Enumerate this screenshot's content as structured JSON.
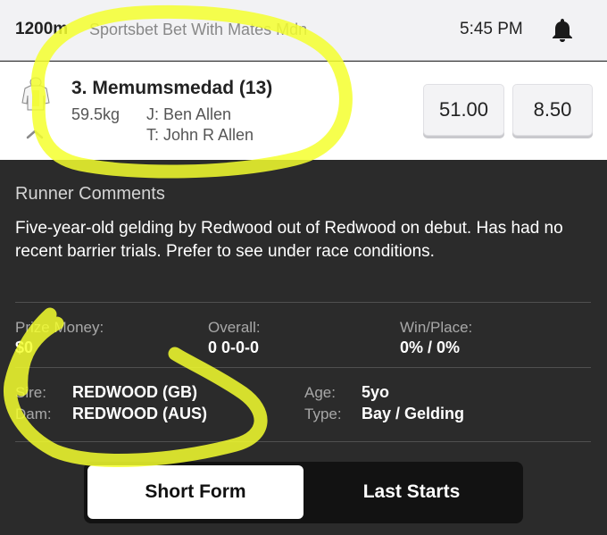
{
  "header": {
    "distance": "1200m",
    "race_name": "Sportsbet Bet With Mates Mdn",
    "time": "5:45 PM",
    "bell_icon": "bell-icon"
  },
  "runner": {
    "name": "3. Memumsmedad (13)",
    "weight": "59.5kg",
    "jockey": "J: Ben Allen",
    "trainer": "T: John R Allen",
    "odds_win": "51.00",
    "odds_place": "8.50",
    "silks_icon": "jockey-silks-icon",
    "collapse_icon": "chevron-up-icon"
  },
  "comments": {
    "title": "Runner Comments",
    "text": "Five-year-old gelding by Redwood out of Redwood on debut. Has had no recent barrier trials. Prefer to see under race conditions."
  },
  "stats": {
    "prize_label": "Prize Money:",
    "prize_value": "$0",
    "overall_label": "Overall:",
    "overall_value": "0 0-0-0",
    "winplace_label": "Win/Place:",
    "winplace_value": "0% / 0%",
    "sire_label": "Sire:",
    "sire_value": "REDWOOD (GB)",
    "dam_label": "Dam:",
    "dam_value": "REDWOOD (AUS)",
    "age_label": "Age:",
    "age_value": "5yo",
    "type_label": "Type:",
    "type_value": "Bay / Gelding"
  },
  "tabs": {
    "short_form": "Short Form",
    "last_starts": "Last Starts"
  },
  "colors": {
    "highlight": "#f4ff2e",
    "dark_panel": "#2b2b2b",
    "header_bg": "#f2f2f4"
  }
}
